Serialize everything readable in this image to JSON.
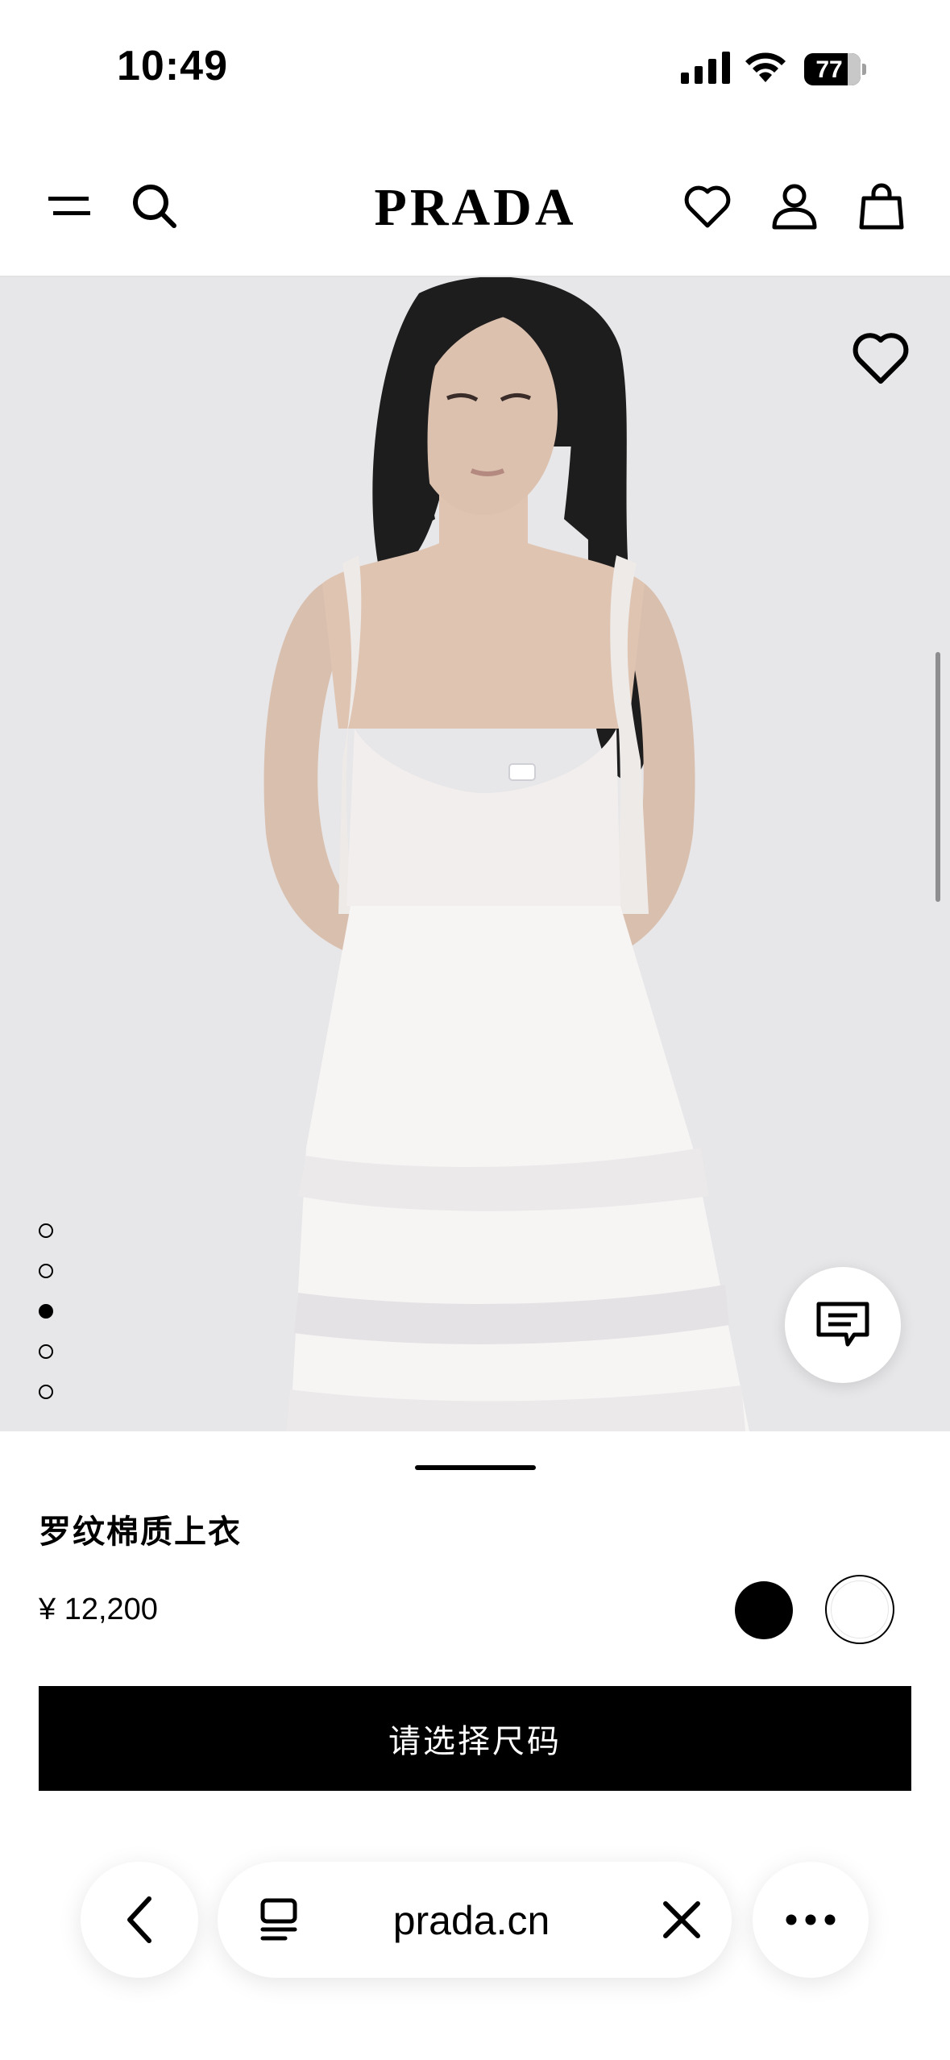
{
  "status_bar": {
    "time": "10:49",
    "battery": "77"
  },
  "header": {
    "brand": "PRADA"
  },
  "carousel": {
    "page_count": 5,
    "active_index": 2
  },
  "product": {
    "name": "罗纹棉质上衣",
    "price": "¥ 12,200",
    "colors": [
      "#000000",
      "#ffffff"
    ],
    "cta_label": "请选择尺码"
  },
  "browser": {
    "url": "prada.cn"
  }
}
